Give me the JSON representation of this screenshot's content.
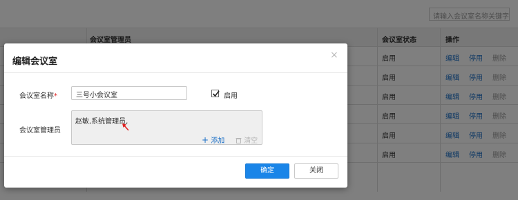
{
  "search": {
    "placeholder": "请输入会议室名称关键字"
  },
  "table": {
    "headers": {
      "admin": "会议室管理员",
      "status": "会议室状态",
      "ops": "操作"
    },
    "rows": [
      {
        "status": "启用",
        "edit": "编辑",
        "disable": "停用",
        "delete": "删除"
      },
      {
        "status": "启用",
        "edit": "编辑",
        "disable": "停用",
        "delete": "删除"
      },
      {
        "status": "启用",
        "edit": "编辑",
        "disable": "停用",
        "delete": "删除"
      },
      {
        "status": "启用",
        "edit": "编辑",
        "disable": "停用",
        "delete": "删除"
      },
      {
        "status": "启用",
        "edit": "编辑",
        "disable": "停用",
        "delete": "删除"
      },
      {
        "status": "启用",
        "edit": "编辑",
        "disable": "停用",
        "delete": "删除"
      }
    ]
  },
  "modal": {
    "title": "编辑会议室",
    "close_icon": "×",
    "name_label": "会议室名称",
    "required_mark": "*",
    "name_value": "三号小会议室",
    "enable_label": "启用",
    "enable_checked": true,
    "admin_label": "会议室管理员",
    "admin_value": "赵敏,系统管理员,",
    "add_label": "添加",
    "add_icon": "+",
    "clear_label": "清空",
    "confirm_label": "确定",
    "close_label": "关闭"
  },
  "colors": {
    "accent": "#1a85e8",
    "link": "#1a6fc7",
    "required": "#e02020",
    "annotation_arrow": "#e02020"
  }
}
